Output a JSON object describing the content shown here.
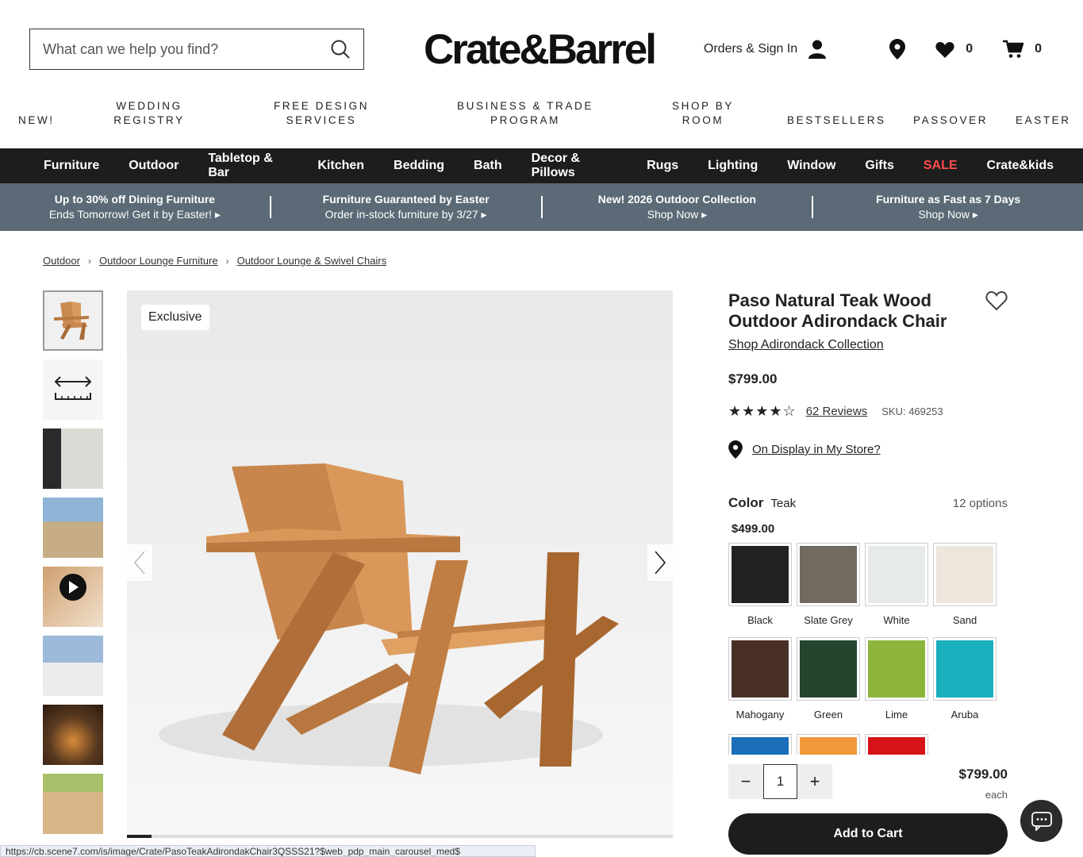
{
  "search": {
    "placeholder": "What can we help you find?"
  },
  "logo": "Crate&Barrel",
  "header": {
    "orders_label": "Orders & Sign In",
    "wishlist_count": "0",
    "cart_count": "0"
  },
  "topnav": [
    "NEW!",
    "WEDDING REGISTRY",
    "FREE DESIGN SERVICES",
    "BUSINESS & TRADE PROGRAM",
    "SHOP BY ROOM",
    "BESTSELLERS",
    "PASSOVER",
    "EASTER"
  ],
  "topnav_lines": {
    "wedding": [
      "WEDDING",
      "REGISTRY"
    ],
    "design": [
      "FREE DESIGN",
      "SERVICES"
    ],
    "business": [
      "BUSINESS & TRADE",
      "PROGRAM"
    ],
    "room": [
      "SHOP BY",
      "ROOM"
    ]
  },
  "categories": [
    "Furniture",
    "Outdoor",
    "Tabletop & Bar",
    "Kitchen",
    "Bedding",
    "Bath",
    "Decor & Pillows",
    "Rugs",
    "Lighting",
    "Window",
    "Gifts",
    "SALE",
    "Crate&kids"
  ],
  "promos": [
    {
      "line1": "Up to 30% off Dining Furniture",
      "line2": "Ends Tomorrow! Get it by Easter! ▸"
    },
    {
      "line1": "Furniture Guaranteed by Easter",
      "line2": "Order in-stock furniture by 3/27 ▸"
    },
    {
      "line1": "New! 2026 Outdoor Collection",
      "line2": "Shop Now ▸"
    },
    {
      "line1": "Furniture as Fast as 7 Days",
      "line2": "Shop Now ▸"
    }
  ],
  "breadcrumb": [
    "Outdoor",
    "Outdoor Lounge Furniture",
    "Outdoor Lounge & Swivel Chairs"
  ],
  "badge": "Exclusive",
  "product": {
    "title": "Paso Natural Teak Wood Outdoor Adirondack Chair",
    "collection_link": "Shop Adirondack Collection",
    "price": "$799.00",
    "stars": "★★★★☆",
    "rating_value": 4.5,
    "reviews": "62 Reviews",
    "sku": "SKU: 469253",
    "store_link": "On Display in My Store?"
  },
  "color": {
    "label": "Color",
    "selected": "Teak",
    "options_count": "12 options",
    "swatch_price": "$499.00",
    "swatches": [
      {
        "name": "Black",
        "color": "#242220"
      },
      {
        "name": "Slate Grey",
        "color": "#706a60"
      },
      {
        "name": "White",
        "color": "#e6eaea"
      },
      {
        "name": "Sand",
        "color": "#ede6dc"
      },
      {
        "name": "Mahogany",
        "color": "#4a2f26"
      },
      {
        "name": "Green",
        "color": "#26452f"
      },
      {
        "name": "Lime",
        "color": "#8db53b"
      },
      {
        "name": "Aruba",
        "color": "#1ab0be"
      }
    ],
    "partial_colors": [
      "#1a6fb8",
      "#f0983a",
      "#d61319"
    ]
  },
  "cart": {
    "qty": "1",
    "total": "$799.00",
    "each": "each",
    "add_label": "Add to Cart",
    "minus": "−",
    "plus": "+"
  },
  "status_url": "https://cb.scene7.com/is/image/Crate/PasoTeakAdirondakChair3QSSS21?$web_pdp_main_carousel_med$",
  "gallery": {
    "current_index": 1,
    "total": 22
  }
}
